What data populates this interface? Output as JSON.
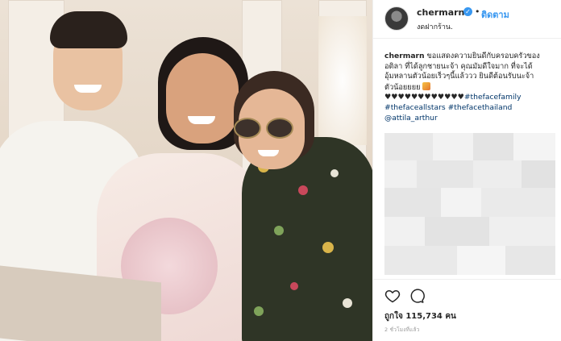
{
  "post": {
    "username": "chermarn",
    "verified_icon": "verified-badge-icon",
    "follow_separator": "•",
    "follow_label": "ติดตาม",
    "location": "งดฝากร้าน.",
    "caption": {
      "author": "chermarn",
      "line1": "ขอแสดงความยินดีกับครอบครัวของ",
      "line2": "อติลา ที่ได้ลูกชายนะจ้า คุณมัมดีใจมาก ที่จะได้",
      "line3": "อุ้มหลานตัวน้อยเร็วๆนี้แล้ววว ยินดีต้อนรับนะจ้า",
      "line4": "ตัวน้อยยยย",
      "hearts": "♥♥♥♥♥♥♥♥♥♥♥♥",
      "hashtag1": "#thefacefamily",
      "hashtag2": "#thefaceallstars",
      "hashtag3": "#thefacethailand",
      "mention": "@attila_arthur"
    },
    "likes_label": "ถูกใจ 115,734 คน",
    "timestamp": "2 ชั่วโมงที่แล้ว"
  },
  "icons": {
    "like": "heart-icon",
    "comment": "comment-icon"
  },
  "colors": {
    "link_blue": "#3897f0",
    "hashtag_navy": "#003569",
    "text": "#262626",
    "muted": "#999999",
    "divider": "#efefef"
  }
}
